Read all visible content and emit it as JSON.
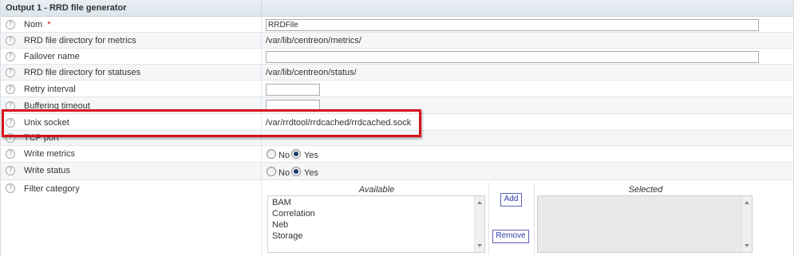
{
  "section": {
    "title": "Output 1 - RRD file generator"
  },
  "help_glyph": "?",
  "fields": {
    "nom": {
      "label": "Nom",
      "required_mark": "*",
      "value": "RRDFile"
    },
    "rrd_metrics_dir": {
      "label": "RRD file directory for metrics",
      "value": "/var/lib/centreon/metrics/"
    },
    "failover": {
      "label": "Failover name",
      "value": ""
    },
    "rrd_status_dir": {
      "label": "RRD file directory for statuses",
      "value": "/var/lib/centreon/status/"
    },
    "retry_interval": {
      "label": "Retry interval",
      "value": ""
    },
    "buffering_timeout": {
      "label": "Buffering timeout",
      "value": ""
    },
    "unix_socket": {
      "label": "Unix socket",
      "value": "/var/rrdtool/rrdcached/rrdcached.sock"
    },
    "tcp_port": {
      "label": "TCP port",
      "value": ""
    },
    "write_metrics": {
      "label": "Write metrics",
      "options": [
        "No",
        "Yes"
      ],
      "selected": "Yes"
    },
    "write_status": {
      "label": "Write status",
      "options": [
        "No",
        "Yes"
      ],
      "selected": "Yes"
    },
    "filter_category": {
      "label": "Filter category",
      "available_header": "Available",
      "selected_header": "Selected",
      "available": [
        "BAM",
        "Correlation",
        "Neb",
        "Storage"
      ],
      "selected": [],
      "add_label": "Add",
      "remove_label": "Remove"
    }
  },
  "colors": {
    "highlight": "#d6121c",
    "required": "#d81010",
    "button_text": "#2a3aa8"
  }
}
